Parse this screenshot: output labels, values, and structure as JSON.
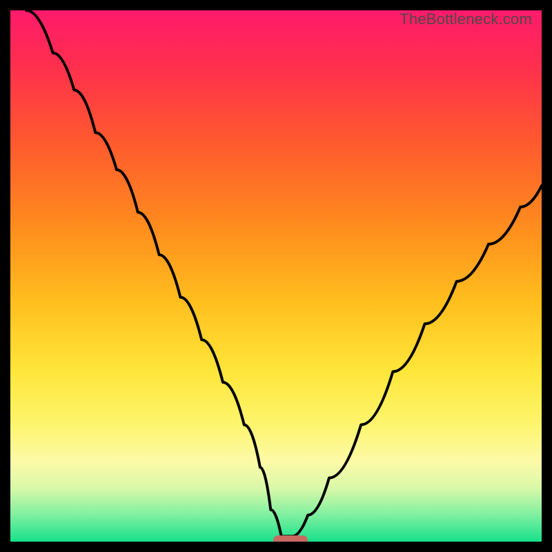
{
  "credit": "TheBottleneck.com",
  "colors": {
    "frame": "#000000",
    "curve": "#000000",
    "marker": "#c76a60",
    "gradient_stops": [
      {
        "offset": 0.0,
        "color": "#ff1a6c"
      },
      {
        "offset": 0.1,
        "color": "#ff2e4e"
      },
      {
        "offset": 0.25,
        "color": "#ff5a2e"
      },
      {
        "offset": 0.4,
        "color": "#ff8a1e"
      },
      {
        "offset": 0.55,
        "color": "#ffbf1e"
      },
      {
        "offset": 0.68,
        "color": "#ffe63a"
      },
      {
        "offset": 0.78,
        "color": "#fdf56e"
      },
      {
        "offset": 0.85,
        "color": "#fcfaa8"
      },
      {
        "offset": 0.9,
        "color": "#d8f8a8"
      },
      {
        "offset": 0.95,
        "color": "#7ef0a0"
      },
      {
        "offset": 1.0,
        "color": "#17e08a"
      }
    ]
  },
  "chart_data": {
    "type": "line",
    "title": "",
    "xlabel": "",
    "ylabel": "",
    "xlim": [
      0,
      100
    ],
    "ylim": [
      0,
      100
    ],
    "description": "V-shaped bottleneck curve. Left branch descends steeply from top-left, flattens near optimum around x≈52; right branch rises less steeply toward upper-right. Background gradient encodes bottleneck severity (red=high, green=low).",
    "series": [
      {
        "name": "bottleneck-curve",
        "x": [
          3,
          8,
          12,
          16,
          20,
          24,
          28,
          32,
          36,
          40,
          44,
          47,
          49,
          51,
          53,
          56,
          60,
          66,
          72,
          78,
          84,
          90,
          96,
          100
        ],
        "y": [
          100,
          92,
          85,
          77,
          70,
          62,
          54,
          46,
          38,
          30,
          22,
          14,
          6,
          1,
          1,
          5,
          12,
          22,
          32,
          41,
          49,
          56,
          63,
          67
        ]
      }
    ],
    "optimum_marker": {
      "x_start": 49.5,
      "x_end": 56,
      "y": 0.3
    }
  }
}
